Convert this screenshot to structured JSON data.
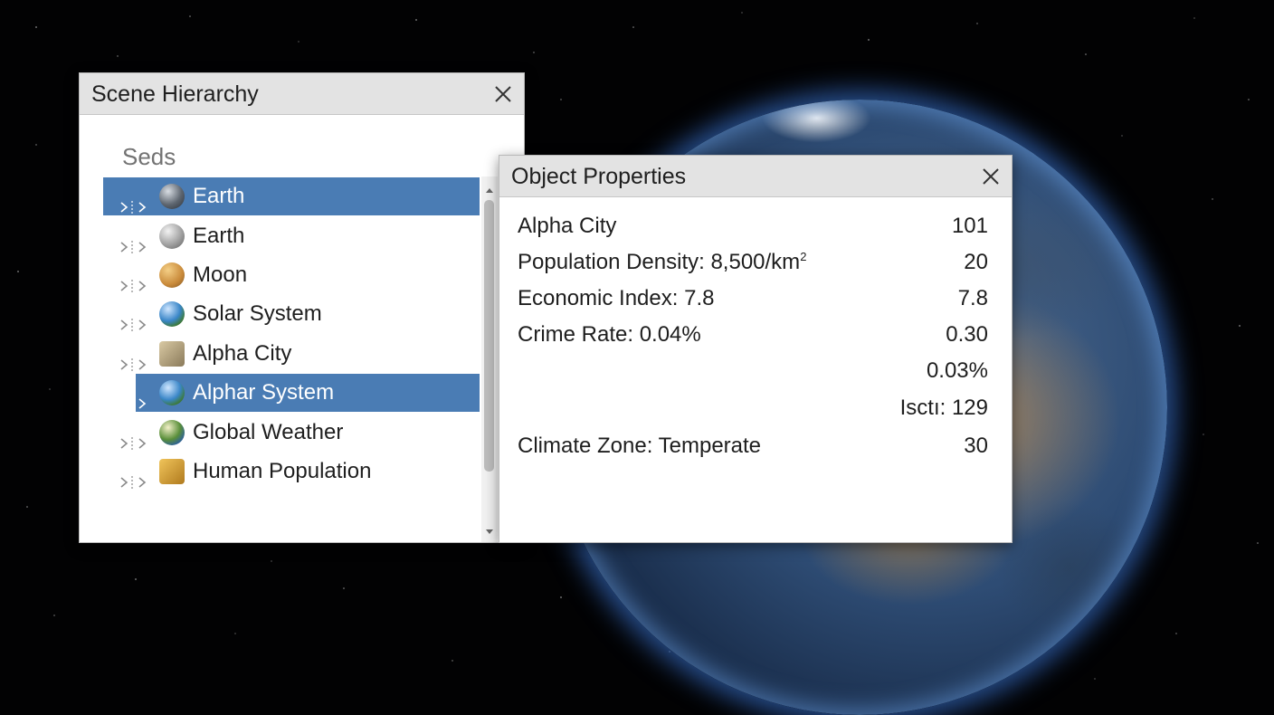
{
  "hierarchy": {
    "title": "Scene Hierarchy",
    "section_label": "Seds",
    "items": [
      {
        "label": "Earth",
        "icon": "sphere-dark-icon",
        "selected": true
      },
      {
        "label": "Earth",
        "icon": "sphere-gray-icon",
        "selected": false
      },
      {
        "label": "Moon",
        "icon": "sphere-orange-icon",
        "selected": false
      },
      {
        "label": "Solar System",
        "icon": "globe-icon",
        "selected": false
      },
      {
        "label": "Alpha City",
        "icon": "city-icon",
        "selected": false
      },
      {
        "label": "Alphar System",
        "icon": "globe-icon",
        "selected": true
      },
      {
        "label": "Global Weather",
        "icon": "weather-globe-icon",
        "selected": false
      },
      {
        "label": "Human Population",
        "icon": "population-box-icon",
        "selected": false
      }
    ]
  },
  "properties": {
    "title": "Object Properties",
    "rows": [
      {
        "name": "Alpha City",
        "value": "101"
      },
      {
        "name": "Population Density: 8,500/km",
        "sup": "2",
        "value": "20"
      },
      {
        "name": "Economic Index: 7.8",
        "value": "7.8"
      },
      {
        "name": "Crime Rate: 0.04%",
        "value": "0.30"
      },
      {
        "name": "",
        "value": "0.03%"
      },
      {
        "name": "",
        "value": "Isctı: 129"
      },
      {
        "name": "Climate Zone: Temperate",
        "value": "30"
      }
    ]
  },
  "colors": {
    "selection": "#4a7cb4",
    "titlebar": "#e3e3e3",
    "background": "#020203"
  }
}
